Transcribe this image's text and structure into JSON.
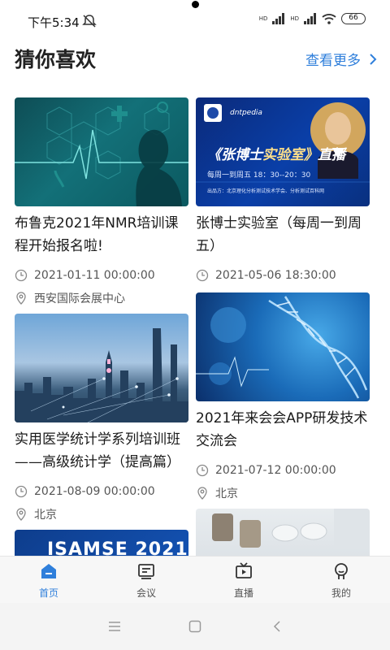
{
  "status_bar": {
    "time": "下午5:34",
    "signal1": "HD",
    "signal2": "HD",
    "battery": "66"
  },
  "header": {
    "title": "猜你喜欢",
    "view_more": "查看更多"
  },
  "cards": [
    {
      "title": "布鲁克2021年NMR培训课程开始报名啦!",
      "date": "2021-01-11 00:00:00",
      "location": "西安国际会展中心"
    },
    {
      "title": "张博士实验室（每周一到周五）",
      "date": "2021-05-06 18:30:00",
      "thumb_text": {
        "brand": "dntpedia",
        "headline1": "《张博士",
        "headline2": "实验室》",
        "headline3": "直播",
        "schedule": "每周一到周五  18：30--20：30",
        "producer": "出品方：北京理化分析测试技术学会、分析测试百科网"
      }
    },
    {
      "title": "实用医学统计学系列培训班——高级统计学（提高篇）",
      "date": "2021-08-09 00:00:00",
      "location": "北京"
    },
    {
      "title": "2021年来会会APP研发技术交流会",
      "date": "2021-07-12 00:00:00",
      "location": "北京"
    },
    {
      "thumb_text": "ISAMSE 2021"
    }
  ],
  "tabs": [
    {
      "label": "首页",
      "icon": "home-icon"
    },
    {
      "label": "会议",
      "icon": "meeting-icon"
    },
    {
      "label": "直播",
      "icon": "live-tv-icon"
    },
    {
      "label": "我的",
      "icon": "profile-icon"
    }
  ],
  "colors": {
    "accent": "#2f7fdb"
  }
}
